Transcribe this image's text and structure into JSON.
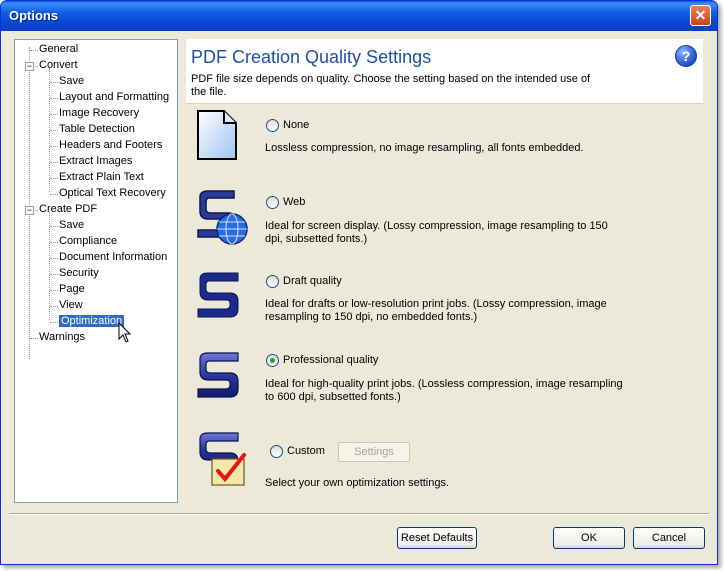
{
  "window": {
    "title": "Options"
  },
  "tree": [
    {
      "label": "General",
      "level": 0
    },
    {
      "label": "Convert",
      "level": 0,
      "expander": "−"
    },
    {
      "label": "Save",
      "level": 1
    },
    {
      "label": "Layout and Formatting",
      "level": 1
    },
    {
      "label": "Image Recovery",
      "level": 1
    },
    {
      "label": "Table Detection",
      "level": 1
    },
    {
      "label": "Headers and Footers",
      "level": 1
    },
    {
      "label": "Extract Images",
      "level": 1
    },
    {
      "label": "Extract Plain Text",
      "level": 1
    },
    {
      "label": "Optical Text Recovery",
      "level": 1
    },
    {
      "label": "Create PDF",
      "level": 0,
      "expander": "−"
    },
    {
      "label": "Save",
      "level": 1
    },
    {
      "label": "Compliance",
      "level": 1
    },
    {
      "label": "Document Information",
      "level": 1
    },
    {
      "label": "Security",
      "level": 1
    },
    {
      "label": "Page",
      "level": 1
    },
    {
      "label": "View",
      "level": 1
    },
    {
      "label": "Optimization",
      "level": 1,
      "selected": true
    },
    {
      "label": "Warnings",
      "level": 0
    }
  ],
  "panel": {
    "title": "PDF Creation Quality Settings",
    "description": "PDF file size depends on quality. Choose the setting based on the intended use of the file.",
    "options": [
      {
        "label": "None",
        "desc": "Lossless compression, no image resampling, all fonts embedded.",
        "checked": false
      },
      {
        "label": "Web",
        "desc": "Ideal for screen display. (Lossy compression, image resampling to 150 dpi, subsetted fonts.)",
        "checked": false
      },
      {
        "label": "Draft quality",
        "desc": "Ideal for drafts or low-resolution print jobs. (Lossy compression, image resampling to 150 dpi, no embedded fonts.)",
        "checked": false
      },
      {
        "label": "Professional quality",
        "desc": "Ideal for high-quality print jobs. (Lossless compression, image resampling to 600 dpi, subsetted fonts.)",
        "checked": true
      },
      {
        "label": "Custom",
        "desc": "Select your own optimization settings.",
        "checked": false
      }
    ],
    "settings_label": "Settings"
  },
  "footer": {
    "reset_label": "Reset Defaults",
    "ok_label": "OK",
    "cancel_label": "Cancel"
  }
}
